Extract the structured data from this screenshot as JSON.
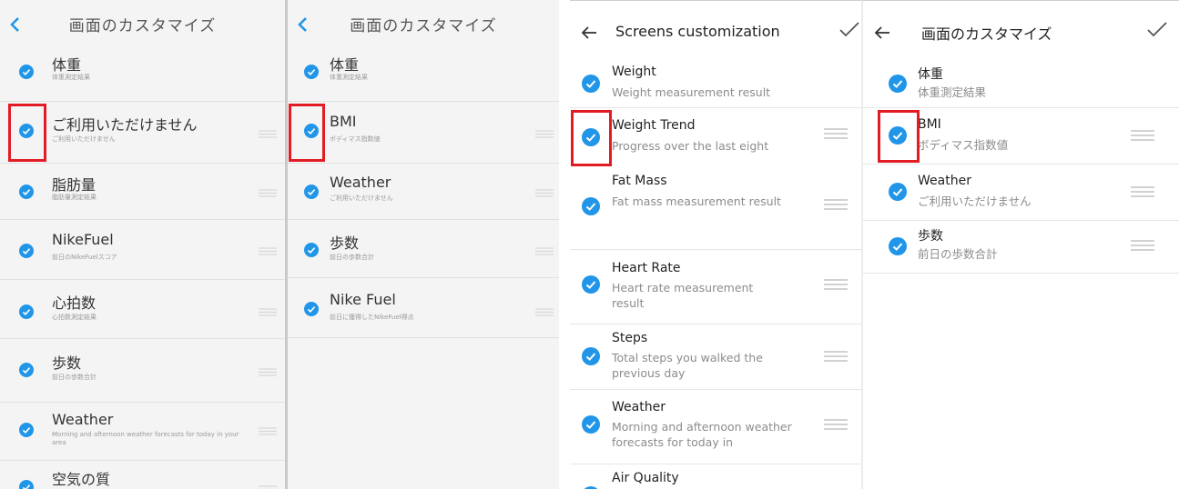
{
  "panel1": {
    "title": "画面のカスタマイズ",
    "items": [
      {
        "title": "体重",
        "subtitle": "体重測定結果"
      },
      {
        "title": "ご利用いただけません",
        "subtitle": "ご利用いただけません"
      },
      {
        "title": "脂肪量",
        "subtitle": "脂肪量測定結果"
      },
      {
        "title": "NikeFuel",
        "subtitle": "前日のNikeFuelスコア"
      },
      {
        "title": "心拍数",
        "subtitle": "心拍数測定結果"
      },
      {
        "title": "歩数",
        "subtitle": "前日の歩数合計"
      },
      {
        "title": "Weather",
        "subtitle": "Morning and afternoon weather forecasts for today in your area"
      },
      {
        "title": "空気の質",
        "subtitle": ""
      }
    ]
  },
  "panel2": {
    "title": "画面のカスタマイズ",
    "items": [
      {
        "title": "体重",
        "subtitle": "体重測定結果"
      },
      {
        "title": "BMI",
        "subtitle": "ボディマス指数値"
      },
      {
        "title": "Weather",
        "subtitle": "ご利用いただけません"
      },
      {
        "title": "歩数",
        "subtitle": "前日の歩数合計"
      },
      {
        "title": "Nike Fuel",
        "subtitle": "前日に獲得したNikeFuel得点"
      }
    ]
  },
  "panel3": {
    "title": "Screens customization",
    "items": [
      {
        "title": "Weight",
        "subtitle": "Weight measurement result"
      },
      {
        "title": "Weight Trend",
        "subtitle": "Progress over the last eight"
      },
      {
        "title": "Fat Mass",
        "subtitle": "Fat mass measurement result"
      },
      {
        "title": "Heart Rate",
        "subtitle": "Heart rate measurement result"
      },
      {
        "title": "Steps",
        "subtitle": "Total steps you walked the previous day"
      },
      {
        "title": "Weather",
        "subtitle": "Morning and afternoon weather forecasts for today in"
      },
      {
        "title": "Air Quality",
        "subtitle": ""
      }
    ]
  },
  "panel4": {
    "title": "画面のカスタマイズ",
    "items": [
      {
        "title": "体重",
        "subtitle": "体重測定結果"
      },
      {
        "title": "BMI",
        "subtitle": "ボディマス指数値"
      },
      {
        "title": "Weather",
        "subtitle": "ご利用いただけません"
      },
      {
        "title": "歩数",
        "subtitle": "前日の歩数合計"
      }
    ]
  },
  "icons": {
    "back_old": "chevron-left-icon",
    "back_new": "arrow-left-icon",
    "confirm": "check-icon",
    "toggle": "checkbox-checked-icon",
    "drag": "drag-handle-icon"
  },
  "colors": {
    "accent": "#2196e8",
    "highlight": "#e31c24",
    "old_background": "#f4f4f4",
    "new_background": "#ffffff"
  }
}
